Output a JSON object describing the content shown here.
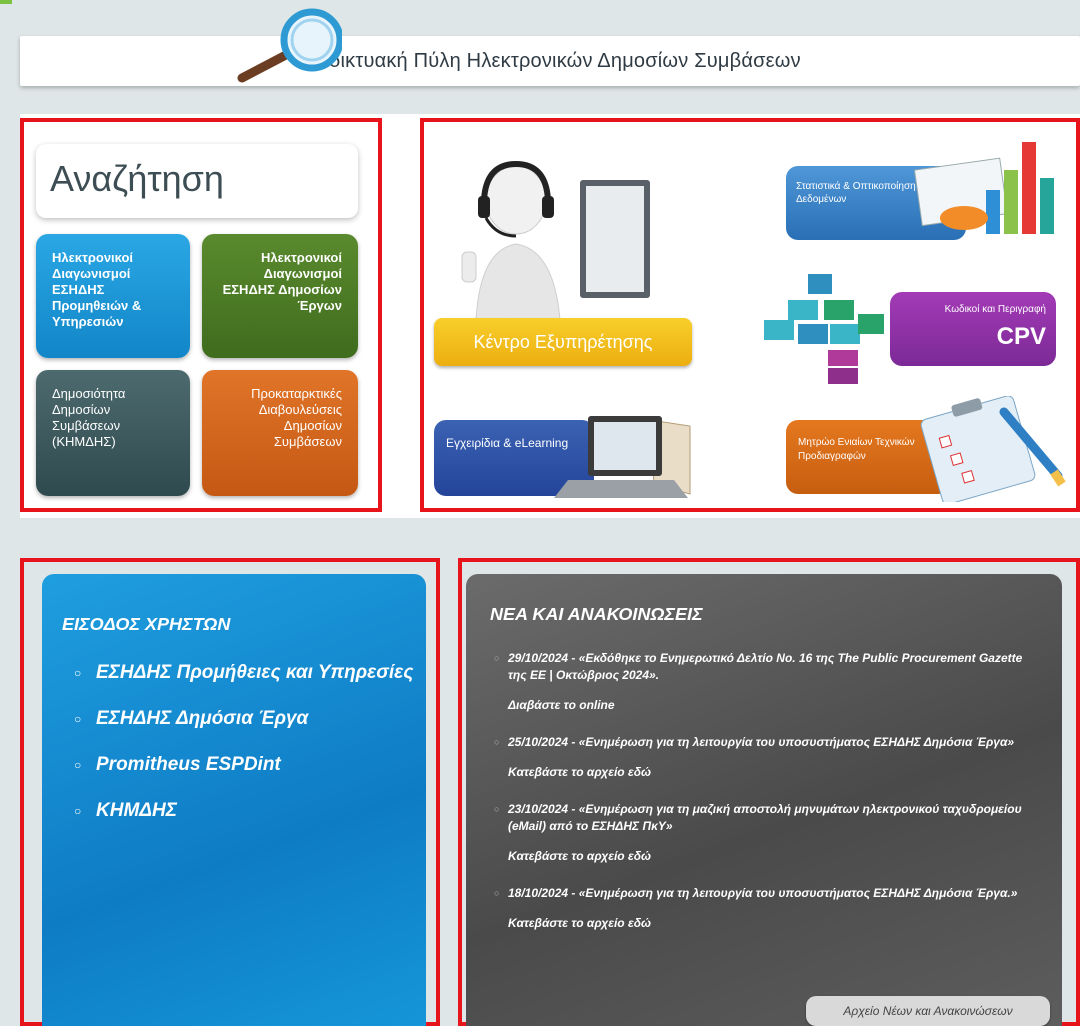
{
  "header": {
    "title": "Διαδικτυακή Πύλη Ηλεκτρονικών Δημοσίων Συμβάσεων"
  },
  "search": {
    "title": "Αναζήτηση",
    "tiles": [
      "Ηλεκτρονικοί Διαγωνισμοί ΕΣΗΔΗΣ Προμηθειών & Υπηρεσιών",
      "Ηλεκτρονικοί Διαγωνισμοί ΕΣΗΔΗΣ Δημοσίων Έργων",
      "Δημοσιότητα Δημοσίων Συμβάσεων (ΚΗΜΔΗΣ)",
      "Προκαταρκτικές Διαβουλεύσεις Δημοσίων Συμβάσεων"
    ]
  },
  "services": {
    "helpdesk": "Κέντρο Εξυπηρέτησης",
    "statistics": "Στατιστικά & Οπτικοποίηση Δεδομένων",
    "cpv_caption": "Κωδικοί και Περιγραφή",
    "cpv_code": "CPV",
    "manuals": "Εγχειρίδια & eLearning",
    "registry": "Μητρώο Ενιαίων Τεχνικών Προδιαγραφών"
  },
  "login": {
    "title": "ΕΙΣΟΔΟΣ ΧΡΗΣΤΩΝ",
    "items": [
      "ΕΣΗΔΗΣ Προμήθειες και Υπηρεσίες",
      "ΕΣΗΔΗΣ Δημόσια Έργα",
      "Promitheus ESPDint",
      "ΚΗΜΔΗΣ"
    ]
  },
  "news": {
    "title": "ΝΕΑ ΚΑΙ ΑΝΑΚΟΙΝΩΣΕΙΣ",
    "items": [
      {
        "text": "29/10/2024 - «Εκδόθηκε το Ενημερωτικό Δελτίο No. 16 της The Public Procurement Gazette της ΕΕ | Οκτώβριος 2024».",
        "link": "Διαβάστε το online"
      },
      {
        "text": "25/10/2024 - «Ενημέρωση για τη λειτουργία του υποσυστήματος ΕΣΗΔΗΣ Δημόσια Έργα»",
        "link": "Κατεβάστε το αρχείο εδώ"
      },
      {
        "text": "23/10/2024 - «Ενημέρωση για τη μαζική αποστολή μηνυμάτων ηλεκτρονικού ταχυδρομείου (eMail) από το ΕΣΗΔΗΣ ΠκΥ»",
        "link": "Κατεβάστε το αρχείο εδώ"
      },
      {
        "text": "18/10/2024 - «Ενημέρωση για τη λειτουργία του υποσυστήματος ΕΣΗΔΗΣ Δημόσια Έργα.»",
        "link": "Κατεβάστε το αρχείο εδώ"
      }
    ],
    "archive": "Αρχείο Νέων και Ανακοινώσεων"
  }
}
